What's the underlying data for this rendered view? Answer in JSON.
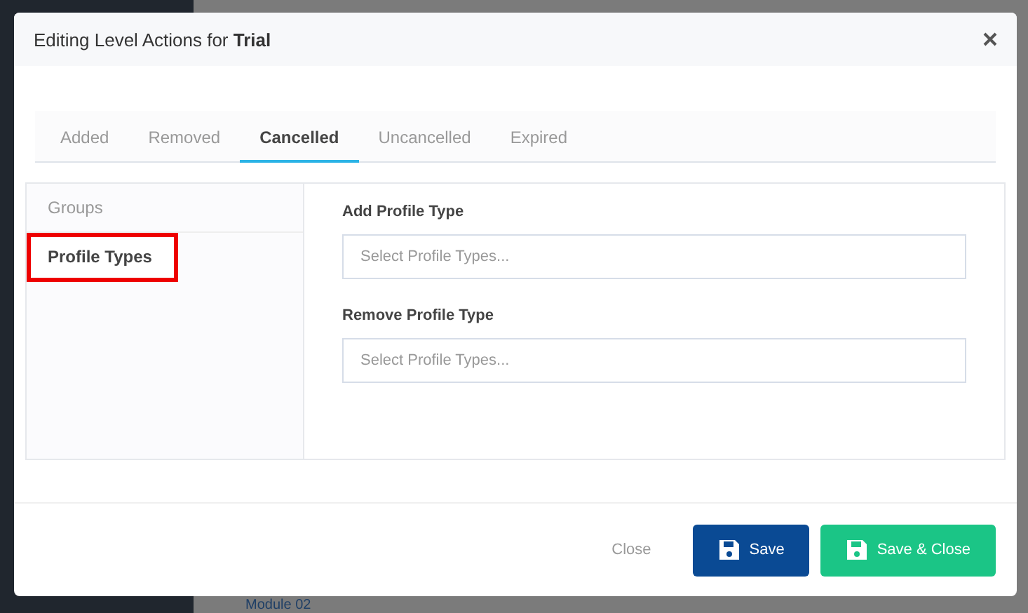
{
  "background": {
    "text": "Module 02"
  },
  "dialog": {
    "title_prefix": "Editing Level Actions for ",
    "title_bold": "Trial"
  },
  "tabs": [
    {
      "label": "Added",
      "selected": false
    },
    {
      "label": "Removed",
      "selected": false
    },
    {
      "label": "Cancelled",
      "selected": true
    },
    {
      "label": "Uncancelled",
      "selected": false
    },
    {
      "label": "Expired",
      "selected": false
    }
  ],
  "side_items": [
    {
      "label": "Groups",
      "selected": false,
      "highlighted": false
    },
    {
      "label": "Profile Types",
      "selected": true,
      "highlighted": true
    }
  ],
  "fields": [
    {
      "label": "Add Profile Type",
      "placeholder": "Select Profile Types..."
    },
    {
      "label": "Remove Profile Type",
      "placeholder": "Select Profile Types..."
    }
  ],
  "footer": {
    "close": "Close",
    "save": "Save",
    "save_close": "Save & Close"
  }
}
